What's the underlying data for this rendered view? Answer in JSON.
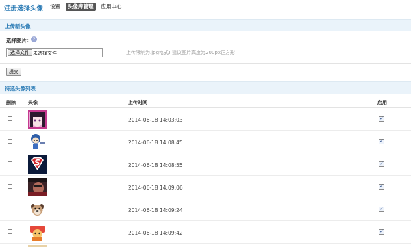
{
  "header": {
    "brand": "注册选择头像",
    "nav": [
      {
        "label": "设置",
        "active": false
      },
      {
        "label": "头像库管理",
        "active": true
      },
      {
        "label": "应用中心",
        "active": false
      }
    ]
  },
  "upload": {
    "section_title": "上传新头像",
    "field_label": "选择图片:",
    "help_icon": "help-icon",
    "file_button": "选择文件",
    "file_status": "未选择文件",
    "hint": "上传限制为.jpg格式! 建议图片高度为200px正方形",
    "submit": "提交"
  },
  "list": {
    "section_title": "待选头像列表",
    "columns": {
      "delete": "删除",
      "avatar": "头像",
      "time": "上传时间",
      "enabled": "启用"
    },
    "rows": [
      {
        "time": "2014-06-18 14:03:03",
        "avatar": "pink-anime-girl",
        "enabled": true
      },
      {
        "time": "2014-06-18 14:08:45",
        "avatar": "blue-cartoon-boy",
        "enabled": true
      },
      {
        "time": "2014-06-18 14:08:55",
        "avatar": "superman-logo",
        "enabled": true
      },
      {
        "time": "2014-06-18 14:09:06",
        "avatar": "dark-portrait",
        "enabled": true
      },
      {
        "time": "2014-06-18 14:09:24",
        "avatar": "bulldog",
        "enabled": true
      },
      {
        "time": "2014-06-18 14:09:42",
        "avatar": "orange-cartoon",
        "enabled": true
      }
    ]
  },
  "colors": {
    "brand": "#2b7bb5",
    "section_bg": "#eaf3fa",
    "active_nav": "#555555"
  }
}
